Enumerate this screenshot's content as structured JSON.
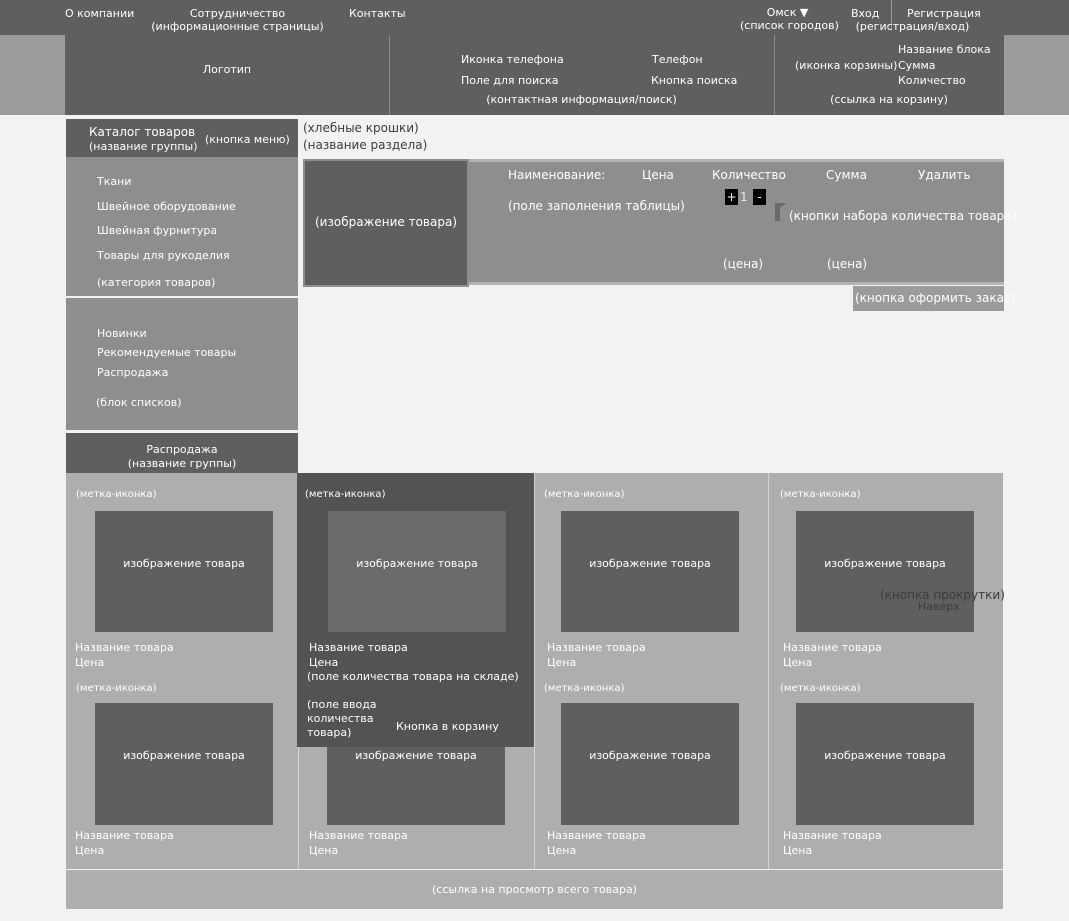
{
  "topnav": {
    "about": "О компании",
    "cooperation_line1": "Сотрудничество",
    "cooperation_line2": "(информационные страницы)",
    "contacts": "Контакты",
    "city": "Омск ▼",
    "city_note": "(список городов)",
    "login": "Вход",
    "register": "Регистрация",
    "auth_note": "(регистрация/вход)"
  },
  "header": {
    "logo": "Логотип",
    "phone_icon": "Иконка телефона",
    "phone": "Телефон",
    "search_field": "Поле для поиска",
    "search_button": "Кнопка поиска",
    "contact_note": "(контактная информация/поиск)",
    "cart_icon": "(иконка корзины)",
    "block_name": "Название блока",
    "sum": "Сумма",
    "quantity": "Количество",
    "cart_link": "(ссылка на корзину)"
  },
  "sidebar": {
    "catalog_title": "Каталог товаров",
    "group_note": "(название группы)",
    "menu_button": "(кнопка меню)",
    "categories": [
      "Ткани",
      "Швейное оборудование",
      "Швейная фурнитура",
      "Товары для рукоделия"
    ],
    "category_note": "(категория товаров)",
    "lists": [
      "Новинки",
      "Рекомендуемые товары",
      "Распродажа"
    ],
    "lists_note": "(блок списков)"
  },
  "breadcrumbs": {
    "crumbs": "(хлебные крошки)",
    "section": "(название раздела)"
  },
  "cart": {
    "image": "(изображение товара)",
    "col_name": "Наименование:",
    "col_price": "Цена",
    "col_qty": "Количество",
    "col_sum": "Сумма",
    "col_delete": "Удалить",
    "fill_note": "(поле заполнения таблицы)",
    "plus": "+",
    "qty_value": "1",
    "minus": "-",
    "qty_buttons_note": "(кнопки набора количества товара)",
    "price_note": "(цена)",
    "sum_note": "(цена)",
    "checkout": "(кнопка оформить заказ)"
  },
  "sale": {
    "title": "Распродажа",
    "group_note": "(название группы)",
    "badge": "(метка-иконка)",
    "image": "изображение товара",
    "product_name": "Название товара",
    "price": "Цена",
    "stock_note": "(поле количества товара  на складе)",
    "qty_input": "(поле ввода количества товара)",
    "to_cart": "Кнопка в корзину",
    "scroll_button": "(кнопка прокрутки)",
    "scroll_top": "Наверх",
    "view_all": "(ссылка на просмотр всего товара)"
  }
}
